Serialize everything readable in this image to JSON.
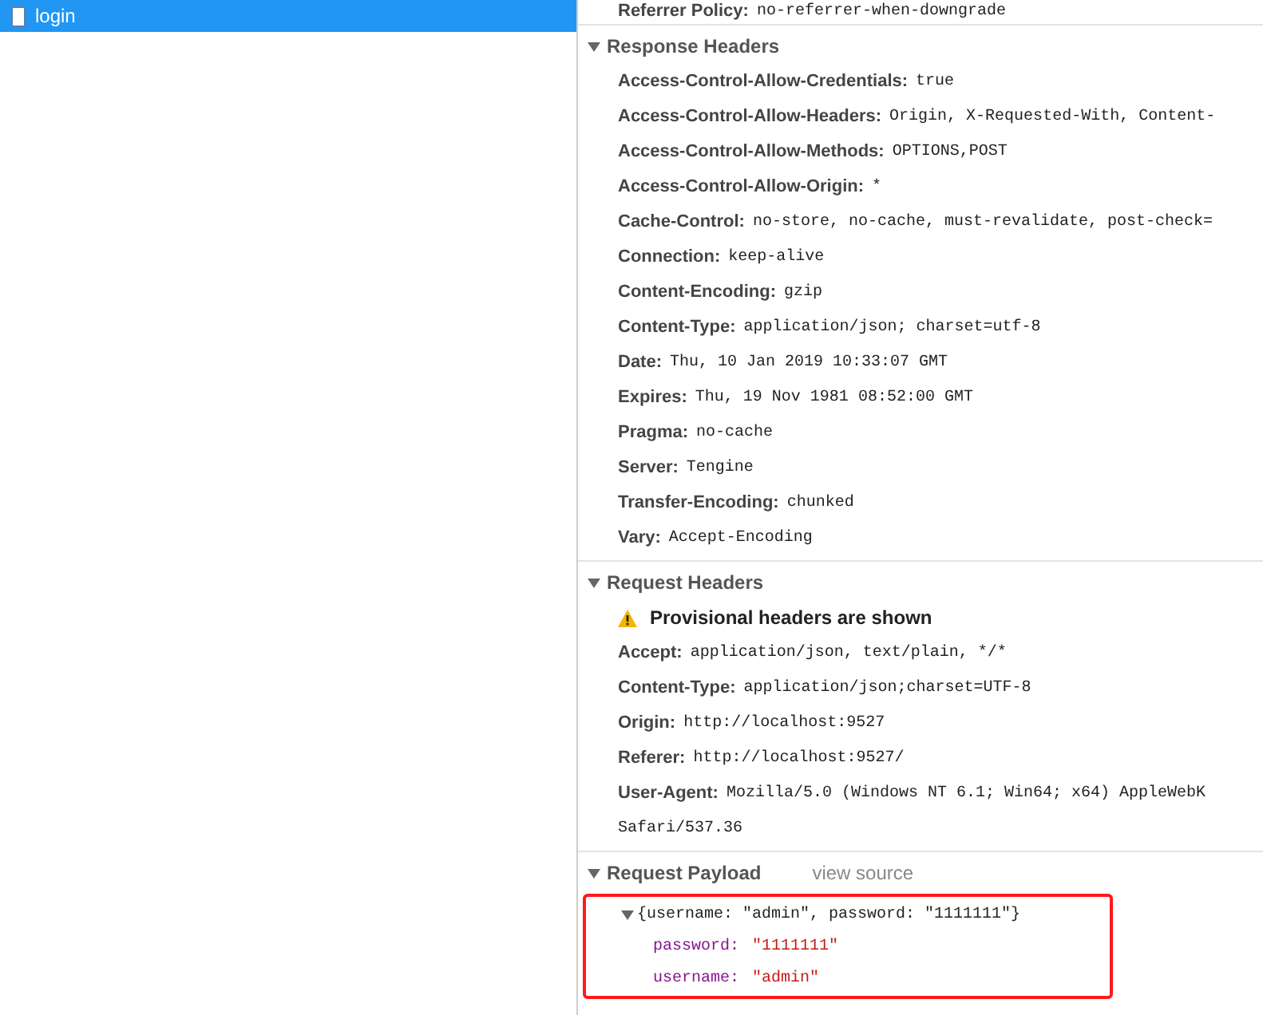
{
  "request_list": [
    {
      "name": "login",
      "selected": true
    }
  ],
  "general_tail": {
    "name": "Referrer Policy:",
    "value": "no-referrer-when-downgrade"
  },
  "sections": [
    {
      "title": "Response Headers",
      "expanded": true,
      "headers": [
        {
          "name": "Access-Control-Allow-Credentials:",
          "value": "true"
        },
        {
          "name": "Access-Control-Allow-Headers:",
          "value": "Origin, X-Requested-With, Content-"
        },
        {
          "name": "Access-Control-Allow-Methods:",
          "value": "OPTIONS,POST"
        },
        {
          "name": "Access-Control-Allow-Origin:",
          "value": "*"
        },
        {
          "name": "Cache-Control:",
          "value": "no-store, no-cache, must-revalidate, post-check="
        },
        {
          "name": "Connection:",
          "value": "keep-alive"
        },
        {
          "name": "Content-Encoding:",
          "value": "gzip"
        },
        {
          "name": "Content-Type:",
          "value": "application/json; charset=utf-8"
        },
        {
          "name": "Date:",
          "value": "Thu, 10 Jan 2019 10:33:07 GMT"
        },
        {
          "name": "Expires:",
          "value": "Thu, 19 Nov 1981 08:52:00 GMT"
        },
        {
          "name": "Pragma:",
          "value": "no-cache"
        },
        {
          "name": "Server:",
          "value": "Tengine"
        },
        {
          "name": "Transfer-Encoding:",
          "value": "chunked"
        },
        {
          "name": "Vary:",
          "value": "Accept-Encoding"
        }
      ]
    },
    {
      "title": "Request Headers",
      "expanded": true,
      "warning": "Provisional headers are shown",
      "headers": [
        {
          "name": "Accept:",
          "value": "application/json, text/plain, */*"
        },
        {
          "name": "Content-Type:",
          "value": "application/json;charset=UTF-8"
        },
        {
          "name": "Origin:",
          "value": "http://localhost:9527"
        },
        {
          "name": "Referer:",
          "value": "http://localhost:9527/"
        },
        {
          "name": "User-Agent:",
          "value": "Mozilla/5.0 (Windows NT 6.1; Win64; x64) AppleWebK",
          "continuation": "Safari/537.36"
        }
      ]
    }
  ],
  "payload": {
    "title": "Request Payload",
    "link": "view source",
    "expanded": true,
    "summary": "{username: \"admin\", password: \"1111111\"}",
    "properties": [
      {
        "key": "password:",
        "value": "\"1111111\""
      },
      {
        "key": "username:",
        "value": "\"admin\""
      }
    ]
  }
}
